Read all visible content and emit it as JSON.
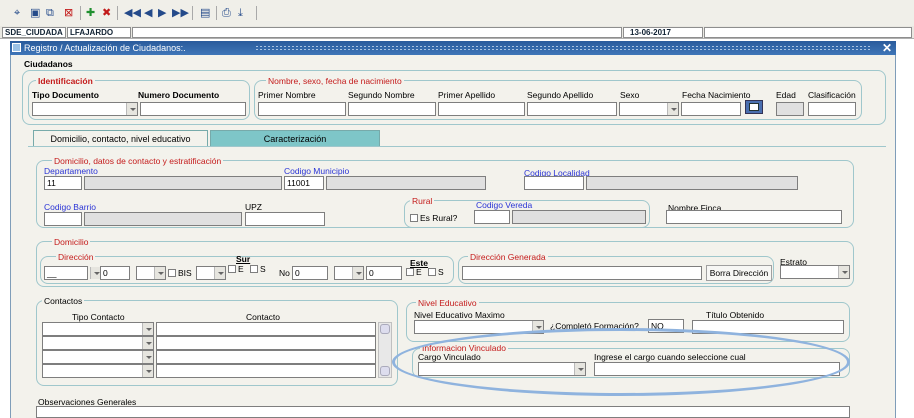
{
  "toolbar": {
    "icons": [
      "find-icon",
      "new-record-icon",
      "copy-icon",
      "close-record-icon",
      "add-icon",
      "delete-icon",
      "first-icon",
      "previous-icon",
      "next-icon",
      "last-icon",
      "save-icon",
      "print-icon",
      "export-icon"
    ]
  },
  "status": {
    "module": "SDE_CIUDADA",
    "user": "LFAJARDO",
    "date": "13-06-2017"
  },
  "window": {
    "title": "Registro / Actualización de Ciudadanos:."
  },
  "ciudadanos": {
    "section": "Ciudadanos",
    "identificacion": {
      "legend": "Identificación",
      "tipo_documento": "Tipo Documento",
      "numero_documento": "Numero Documento"
    },
    "nombre": {
      "legend": "Nombre, sexo, fecha de nacimiento",
      "primer_nombre": "Primer Nombre",
      "segundo_nombre": "Segundo Nombre",
      "primer_apellido": "Primer Apellido",
      "segundo_apellido": "Segundo Apellido",
      "sexo": "Sexo",
      "fecha_nacimiento": "Fecha Nacimiento",
      "edad": "Edad",
      "clasificacion": "Clasificación"
    }
  },
  "tabs": [
    {
      "label": "Domicilio, contacto, nivel educativo"
    },
    {
      "label": "Caracterización"
    }
  ],
  "domicilio_datos": {
    "legend": "Domicilio, datos de contacto y estratificación",
    "departamento": "Departamento",
    "departamento_value": "11",
    "codigo_municipio": "Codigo Municipio",
    "codigo_municipio_value": "11001",
    "codigo_localidad": "Codigo Localidad",
    "codigo_barrio": "Codigo Barrio",
    "upz": "UPZ",
    "rural_legend": "Rural",
    "es_rural": "Es Rural?",
    "codigo_vereda": "Codigo Vereda",
    "nombre_finca": "Nombre Finca"
  },
  "domicilio": {
    "legend": "Domicilio",
    "direccion": "Dirección",
    "via_value": "__",
    "numero_value": "0",
    "bis": "BIS",
    "sur": "Sur",
    "este": "Este",
    "e": "E",
    "s": "S",
    "no": "No",
    "no_value": "0",
    "numero2_value": "0",
    "direccion_generada": "Dirección Generada",
    "borra_direccion": "Borra Dirección",
    "estrato": "Estrato"
  },
  "contactos": {
    "legend": "Contactos",
    "tipo_contacto": "Tipo Contacto",
    "contacto": "Contacto"
  },
  "nivel_educativo": {
    "legend": "Nivel Educativo",
    "nivel_maximo": "Nivel Educativo Maximo",
    "completo": "¿Completó Formación?",
    "completo_value": "NO",
    "titulo": "Título Obtenido"
  },
  "vinculado": {
    "legend": "Informacion Vinculado",
    "cargo": "Cargo Vinculado",
    "ingrese": "Ingrese el cargo cuando seleccione cual"
  },
  "observaciones": {
    "label": "Observaciones Generales"
  }
}
